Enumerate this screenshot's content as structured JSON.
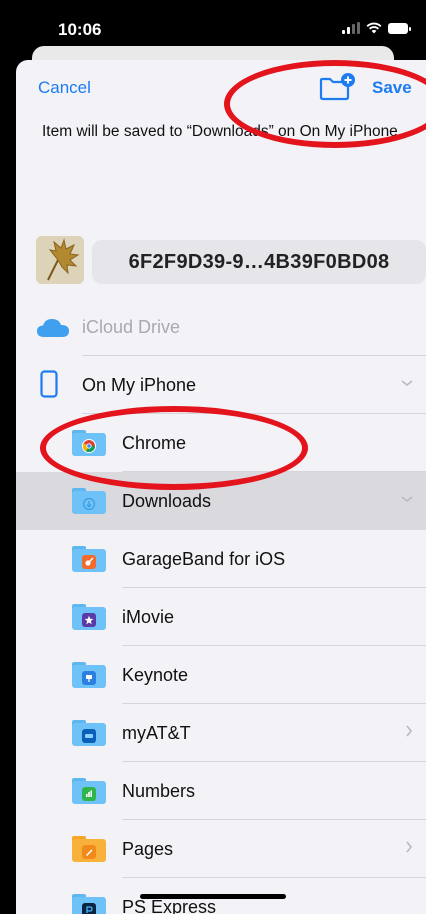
{
  "status_bar": {
    "time": "10:06"
  },
  "nav": {
    "cancel_label": "Cancel",
    "save_label": "Save"
  },
  "save_message": "Item will be saved to “Downloads” on On My iPhone.",
  "file": {
    "name": "6F2F9D39-9…4B39F0BD08"
  },
  "locations": {
    "icloud": "iCloud Drive",
    "on_my_iphone": "On My iPhone",
    "folders": [
      {
        "label": "Chrome",
        "icon": "chrome-icon"
      },
      {
        "label": "Downloads",
        "icon": "download-icon",
        "selected": true
      },
      {
        "label": "GarageBand for iOS",
        "icon": "guitar-icon"
      },
      {
        "label": "iMovie",
        "icon": "star-icon"
      },
      {
        "label": "Keynote",
        "icon": "keynote-icon"
      },
      {
        "label": "myAT&T",
        "icon": "att-icon"
      },
      {
        "label": "Numbers",
        "icon": "numbers-icon"
      },
      {
        "label": "Pages",
        "icon": "pages-icon"
      },
      {
        "label": "PS Express",
        "icon": "ps-express-icon"
      }
    ]
  },
  "colors": {
    "accent": "#1d7cf2",
    "annotation": "#e3141c",
    "selected_row": "#d9d9de"
  }
}
